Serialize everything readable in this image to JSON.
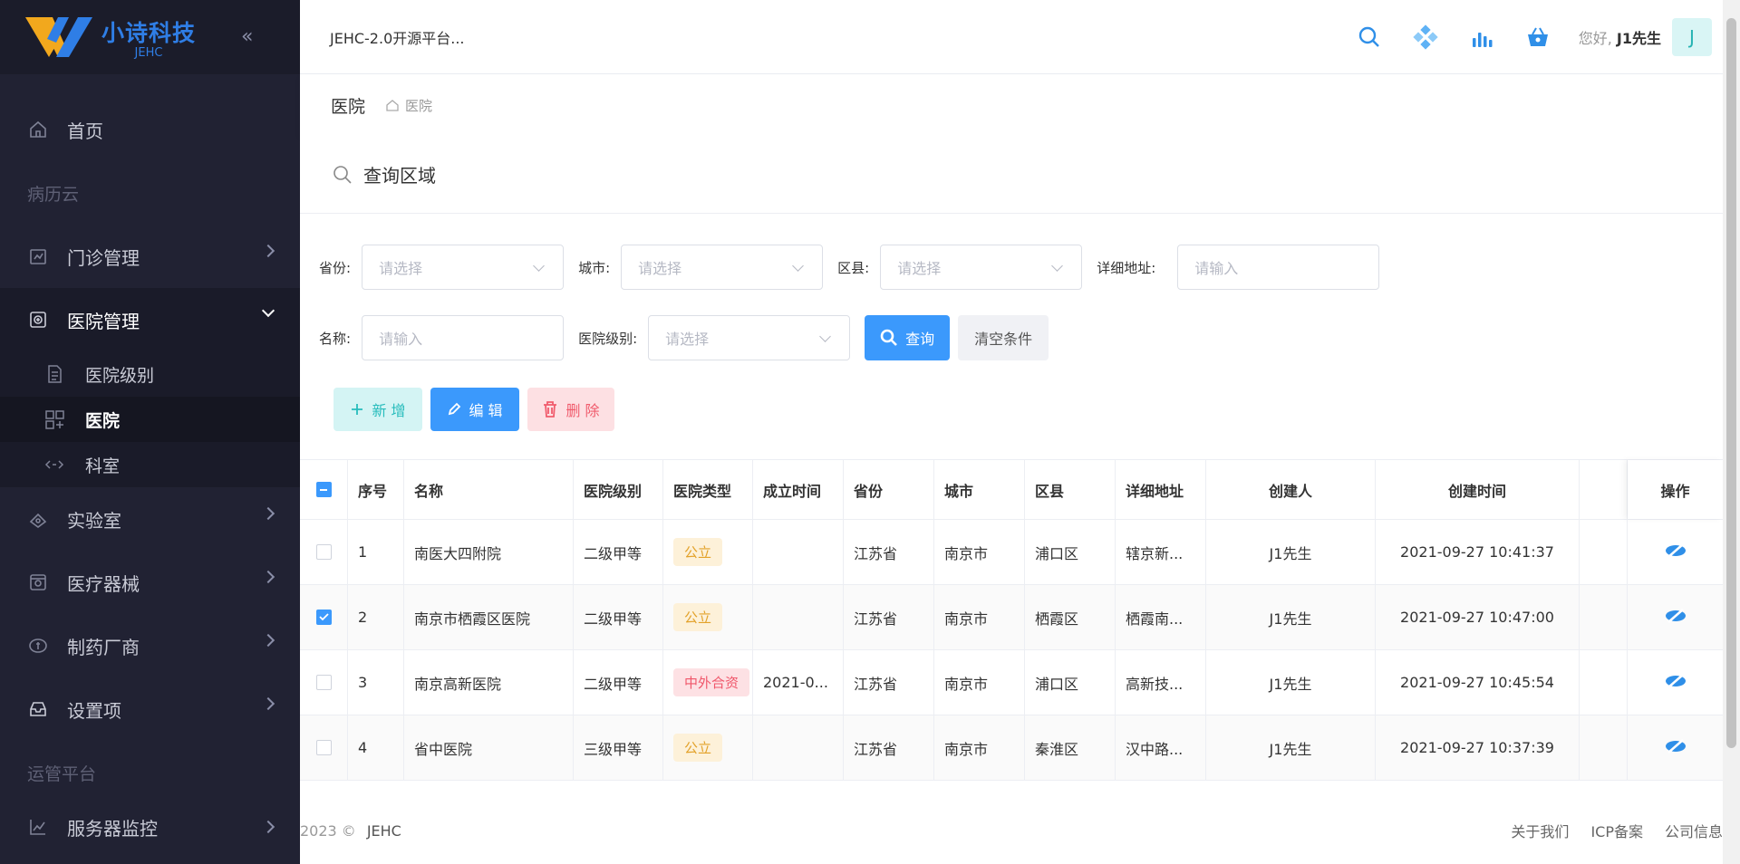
{
  "brand": {
    "name_cn": "小诗科技",
    "name_en": "JEHC"
  },
  "header": {
    "title": "JEHC-2.0开源平台...",
    "greeting": "您好,",
    "user": "J1先生",
    "avatar_letter": "J"
  },
  "sidebar": {
    "home": "首页",
    "group1": "病历云",
    "items": [
      {
        "label": "门诊管理"
      },
      {
        "label": "医院管理"
      },
      {
        "label": "实验室"
      },
      {
        "label": "医疗器械"
      },
      {
        "label": "制药厂商"
      },
      {
        "label": "设置项"
      }
    ],
    "sub_items": [
      {
        "label": "医院级别"
      },
      {
        "label": "医院"
      },
      {
        "label": "科室"
      }
    ],
    "group2": "运管平台",
    "monitor": "服务器监控"
  },
  "breadcrumb": {
    "title": "医院",
    "home": "医院"
  },
  "query": {
    "title": "查询区域",
    "province_label": "省份:",
    "city_label": "城市:",
    "county_label": "区县:",
    "address_label": "详细地址:",
    "name_label": "名称:",
    "level_label": "医院级别:",
    "select_placeholder": "请选择",
    "input_placeholder": "请输入",
    "search_btn": "查询",
    "clear_btn": "清空条件"
  },
  "actions": {
    "add": "新 增",
    "edit": "编 辑",
    "delete": "删 除"
  },
  "table": {
    "headers": [
      "序号",
      "名称",
      "医院级别",
      "医院类型",
      "成立时间",
      "省份",
      "城市",
      "区县",
      "详细地址",
      "创建人",
      "创建时间",
      "操作"
    ],
    "rows": [
      {
        "no": "1",
        "name": "南医大四附院",
        "level": "二级甲等",
        "type": "公立",
        "founded": "",
        "province": "江苏省",
        "city": "南京市",
        "county": "浦口区",
        "address": "辖京新...",
        "creator": "J1先生",
        "created": "2021-09-27 10:41:37",
        "checked": false
      },
      {
        "no": "2",
        "name": "南京市栖霞区医院",
        "level": "二级甲等",
        "type": "公立",
        "founded": "",
        "province": "江苏省",
        "city": "南京市",
        "county": "栖霞区",
        "address": "栖霞南...",
        "creator": "J1先生",
        "created": "2021-09-27 10:47:00",
        "checked": true
      },
      {
        "no": "3",
        "name": "南京高新医院",
        "level": "二级甲等",
        "type": "中外合资",
        "founded": "2021-0...",
        "province": "江苏省",
        "city": "南京市",
        "county": "浦口区",
        "address": "高新技...",
        "creator": "J1先生",
        "created": "2021-09-27 10:45:54",
        "checked": false
      },
      {
        "no": "4",
        "name": "省中医院",
        "level": "三级甲等",
        "type": "公立",
        "founded": "",
        "province": "江苏省",
        "city": "南京市",
        "county": "秦淮区",
        "address": "汉中路...",
        "creator": "J1先生",
        "created": "2021-09-27 10:37:39",
        "checked": false
      }
    ]
  },
  "footer": {
    "copyright": "2023 ©",
    "brand": "JEHC",
    "links": [
      "关于我们",
      "ICP备案",
      "公司信息"
    ]
  },
  "colors": {
    "sidebar_bg": "#212233",
    "primary": "#3b99fc",
    "accent_teal": "#27bcbc",
    "danger": "#f05b6c"
  }
}
